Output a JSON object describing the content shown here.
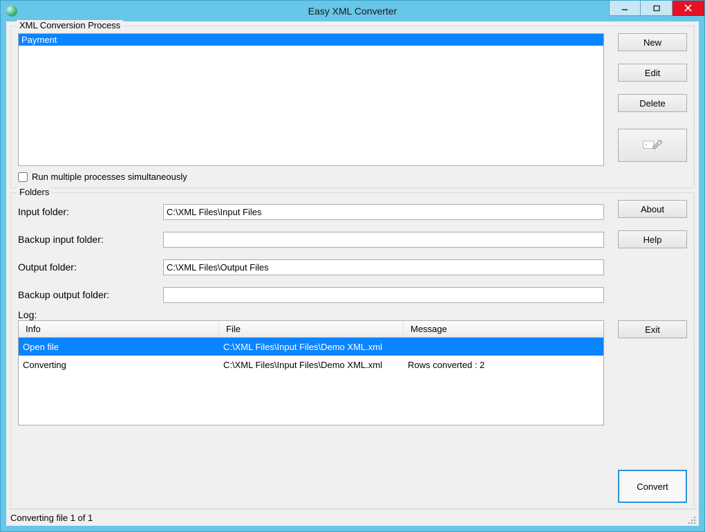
{
  "window": {
    "title": "Easy XML Converter"
  },
  "process": {
    "group_title": "XML Conversion Process",
    "items": [
      "Payment"
    ],
    "selected_index": 0,
    "buttons": {
      "new": "New",
      "edit": "Edit",
      "delete": "Delete"
    },
    "run_multiple_label": "Run multiple processes simultaneously",
    "run_multiple_checked": false
  },
  "folders": {
    "group_title": "Folders",
    "input_folder_label": "Input folder:",
    "input_folder_value": "C:\\XML Files\\Input Files",
    "backup_input_label": "Backup input folder:",
    "backup_input_value": "",
    "output_folder_label": "Output folder:",
    "output_folder_value": "C:\\XML Files\\Output Files",
    "backup_output_label": "Backup output folder:",
    "backup_output_value": "",
    "about_label": "About",
    "help_label": "Help",
    "log_label": "Log:",
    "log_columns": {
      "info": "Info",
      "file": "File",
      "message": "Message"
    },
    "log_rows": [
      {
        "info": "Open file",
        "file": "C:\\XML Files\\Input Files\\Demo XML.xml",
        "message": ""
      },
      {
        "info": "Converting",
        "file": "C:\\XML Files\\Input Files\\Demo XML.xml",
        "message": "Rows converted : 2"
      }
    ],
    "log_selected_index": 0,
    "exit_label": "Exit",
    "convert_label": "Convert"
  },
  "status": {
    "text": "Converting file 1 of 1"
  }
}
